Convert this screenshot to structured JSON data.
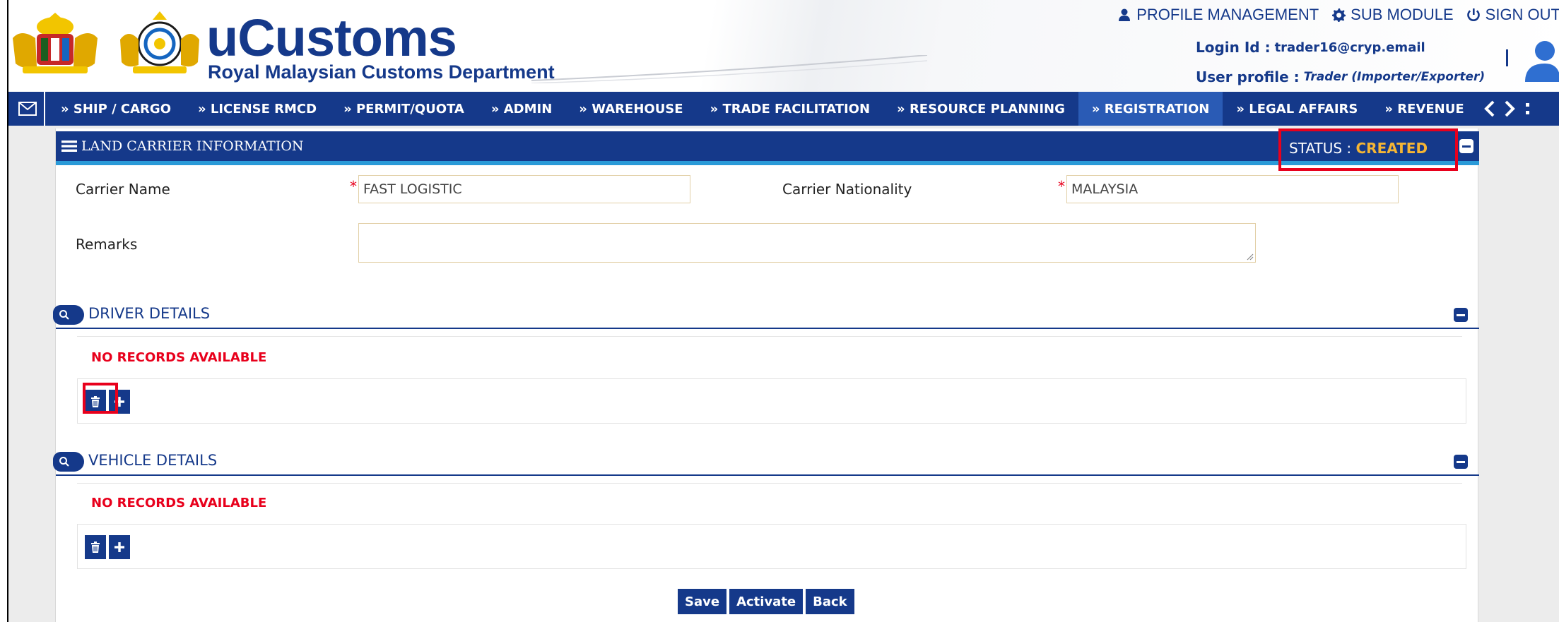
{
  "brand": {
    "title": "uCustoms",
    "subtitle": "Royal Malaysian Customs Department"
  },
  "top_links": {
    "profile": "PROFILE MANAGEMENT",
    "sub_module": "SUB MODULE",
    "sign_out": "SIGN OUT"
  },
  "login": {
    "id_label": "Login Id :",
    "id_value": "trader16@cryp.email",
    "profile_label": "User profile :",
    "profile_value": "Trader (Importer/Exporter)"
  },
  "nav": {
    "items": [
      "» SHIP / CARGO",
      "» LICENSE RMCD",
      "» PERMIT/QUOTA",
      "» ADMIN",
      "» WAREHOUSE",
      "» TRADE FACILITATION",
      "» RESOURCE PLANNING",
      "» REGISTRATION",
      "» LEGAL AFFAIRS",
      "» REVENUE"
    ],
    "active_index": 7
  },
  "panel": {
    "title": "LAND CARRIER INFORMATION",
    "status_label": "STATUS :",
    "status_value": "CREATED"
  },
  "form": {
    "carrier_name_label": "Carrier Name",
    "carrier_name_value": "FAST LOGISTIC",
    "carrier_nationality_label": "Carrier Nationality",
    "carrier_nationality_value": "MALAYSIA",
    "remarks_label": "Remarks",
    "remarks_value": "",
    "required_mark": "*"
  },
  "driver": {
    "title": "DRIVER DETAILS",
    "empty": "NO RECORDS AVAILABLE"
  },
  "vehicle": {
    "title": "VEHICLE DETAILS",
    "empty": "NO RECORDS AVAILABLE"
  },
  "footer": {
    "save": "Save",
    "activate": "Activate",
    "back": "Back"
  },
  "colors": {
    "brand_blue": "#15398a",
    "status_amber": "#f5b534",
    "required_red": "#e8001c",
    "highlight_red": "#e8001c"
  }
}
